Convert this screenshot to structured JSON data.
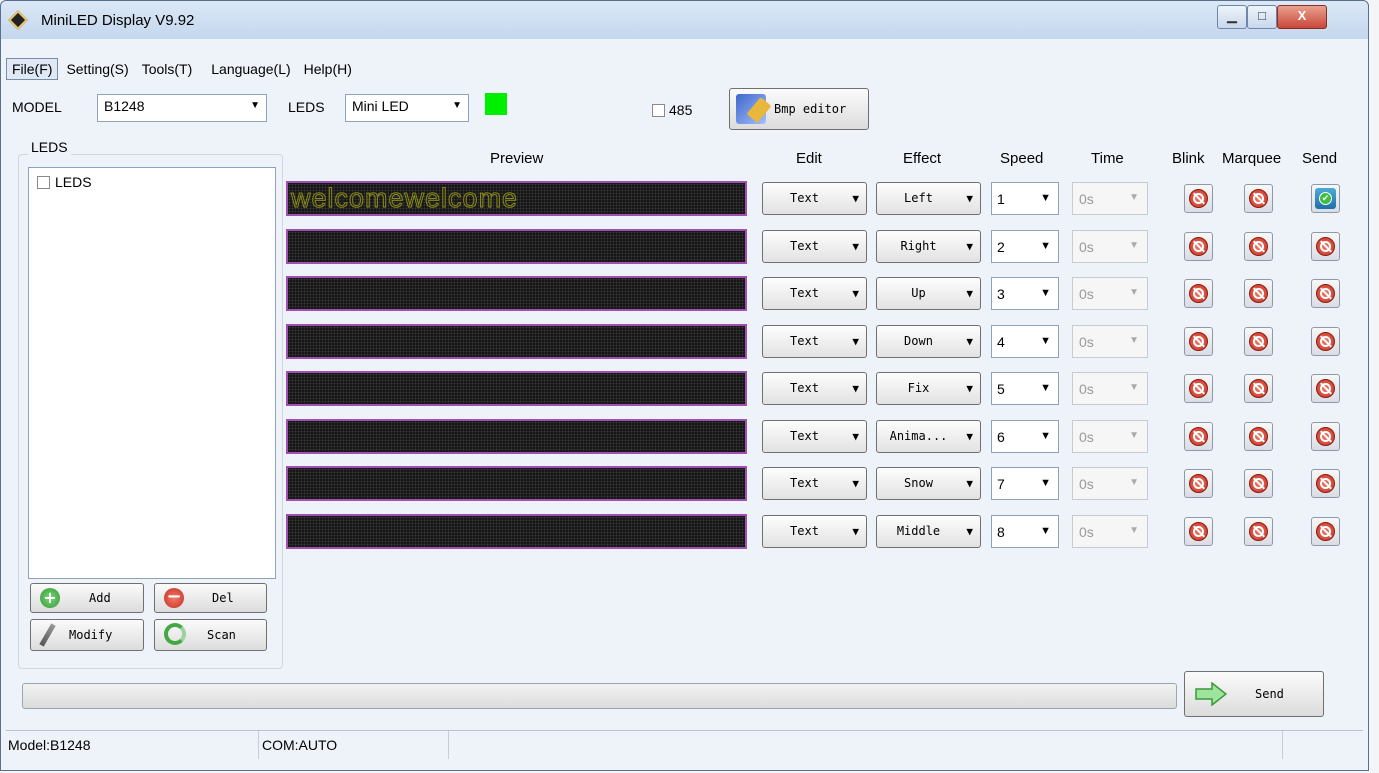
{
  "window": {
    "title": "MiniLED Display V9.92",
    "minimize": "▁",
    "maximize": "□",
    "close": "X"
  },
  "menu": [
    "File(F)",
    "Setting(S)",
    "Tools(T)",
    "Language(L)",
    "Help(H)"
  ],
  "toolbar": {
    "model_label": "MODEL",
    "model_value": "B1248",
    "leds_label": "LEDS",
    "leds_value": "Mini LED",
    "status_color": "#00ee00",
    "checkbox_485_label": "485",
    "checkbox_485_checked": false,
    "bmp_editor_label": "Bmp editor"
  },
  "leds_panel": {
    "group_title": "LEDS",
    "tree_items": [
      {
        "label": "LEDS",
        "checked": false
      }
    ],
    "buttons": {
      "add": "Add",
      "del": "Del",
      "modify": "Modify",
      "scan": "Scan"
    }
  },
  "columns": {
    "preview": "Preview",
    "edit": "Edit",
    "effect": "Effect",
    "speed": "Speed",
    "time": "Time",
    "blink": "Blink",
    "marquee": "Marquee",
    "send": "Send"
  },
  "rows": [
    {
      "preview_text": "welcomewelcome",
      "edit": "Text",
      "effect": "Left",
      "speed": "1",
      "time": "0s",
      "send_enabled": true
    },
    {
      "preview_text": "",
      "edit": "Text",
      "effect": "Right",
      "speed": "2",
      "time": "0s",
      "send_enabled": false
    },
    {
      "preview_text": "",
      "edit": "Text",
      "effect": "Up",
      "speed": "3",
      "time": "0s",
      "send_enabled": false
    },
    {
      "preview_text": "",
      "edit": "Text",
      "effect": "Down",
      "speed": "4",
      "time": "0s",
      "send_enabled": false
    },
    {
      "preview_text": "",
      "edit": "Text",
      "effect": "Fix",
      "speed": "5",
      "time": "0s",
      "send_enabled": false
    },
    {
      "preview_text": "",
      "edit": "Text",
      "effect": "Anima...",
      "speed": "6",
      "time": "0s",
      "send_enabled": false
    },
    {
      "preview_text": "",
      "edit": "Text",
      "effect": "Snow",
      "speed": "7",
      "time": "0s",
      "send_enabled": false
    },
    {
      "preview_text": "",
      "edit": "Text",
      "effect": "Middle",
      "speed": "8",
      "time": "0s",
      "send_enabled": false
    }
  ],
  "send_button_label": "Send",
  "progress": 0,
  "status_bar": {
    "model": "Model:B1248",
    "com": "COM:AUTO"
  }
}
